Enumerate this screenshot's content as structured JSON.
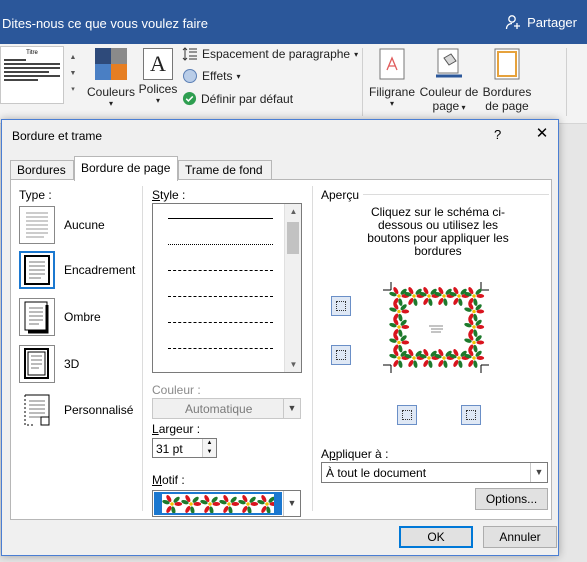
{
  "ribbon": {
    "tell_me": "Dites-nous ce que vous voulez faire",
    "share": "Partager",
    "thumb_title": "Titre",
    "colors": "Couleurs",
    "fonts": "Polices",
    "para_spacing": "Espacement de paragraphe",
    "effects": "Effets",
    "default": "Définir par défaut",
    "watermark": "Filigrane",
    "page_color_1": "Couleur de",
    "page_color_2": "page",
    "page_borders_1": "Bordures",
    "page_borders_2": "de page"
  },
  "dialog": {
    "title": "Bordure et trame",
    "help": "?",
    "close": "✕",
    "tabs": [
      "Bordures",
      "Bordure de page",
      "Trame de fond"
    ],
    "type_label": "Type :",
    "types": [
      "Aucune",
      "Encadrement",
      "Ombre",
      "3D",
      "Personnalisé"
    ],
    "style_label": "Style :",
    "color_label": "Couleur :",
    "color_value": "Automatique",
    "width_label": "Largeur :",
    "width_value": "31 pt",
    "art_label": "Motif :",
    "preview_label": "Aperçu",
    "preview_text": "Cliquez sur le schéma ci-dessous ou utilisez les boutons pour appliquer les bordures",
    "apply_label": "Appliquer à :",
    "apply_value": "À tout le document",
    "options": "Options...",
    "ok": "OK",
    "cancel": "Annuler"
  },
  "colors": {
    "ribbon_blue": "#2b579a",
    "selection": "#1b78d0",
    "flower_red": "#d9141e",
    "leaf_green": "#1d7a2c"
  }
}
